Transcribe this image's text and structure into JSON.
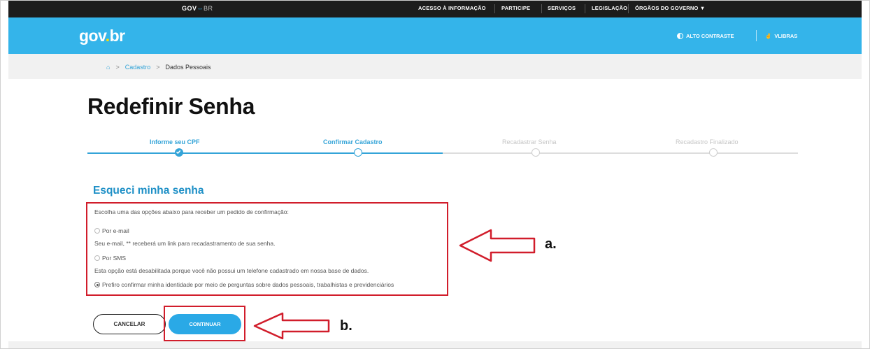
{
  "topbar": {
    "brand": "GOV",
    "brand_suffix": "BR",
    "links": [
      "ACESSO À INFORMAÇÃO",
      "PARTICIPE",
      "SERVIÇOS",
      "LEGISLAÇÃO",
      "ÓRGÃOS DO GOVERNO"
    ]
  },
  "header": {
    "logo_a": "gov",
    "logo_dot": ".",
    "logo_b": "br",
    "contrast_label": "ALTO CONTRASTE",
    "vlibras_label": "VLIBRAS"
  },
  "breadcrumb": {
    "home_icon": "home-icon",
    "items": [
      "Cadastro",
      "Dados Pessoais"
    ]
  },
  "page": {
    "title": "Redefinir Senha"
  },
  "stepper": {
    "steps": [
      {
        "label": "Informe seu CPF",
        "status": "done"
      },
      {
        "label": "Confirmar Cadastro",
        "status": "current"
      },
      {
        "label": "Recadastrar Senha",
        "status": "pending"
      },
      {
        "label": "Recadastro Finalizado",
        "status": "pending"
      }
    ]
  },
  "form": {
    "section_title": "Esqueci minha senha",
    "intro": "Escolha uma das opções abaixo para receber um pedido de confirmação:",
    "options": [
      {
        "label": "Por e-mail",
        "hint": "Seu e-mail, ** receberá um link para recadastramento de sua senha.",
        "selected": false
      },
      {
        "label": "Por SMS",
        "hint": "Esta opção está desabilitada porque você não possui um telefone cadastrado em nossa base de dados.",
        "selected": false
      },
      {
        "label": "Prefiro confirmar minha identidade por meio de perguntas sobre dados pessoais, trabalhistas e previdenciários",
        "hint": "",
        "selected": true
      }
    ],
    "cancel_label": "CANCELAR",
    "continue_label": "CONTINUAR"
  },
  "annotations": {
    "a": "a.",
    "b": "b."
  },
  "colors": {
    "accent": "#34b4ea",
    "primary_button": "#2aa9e6",
    "highlight_red": "#d11d2b",
    "topbar": "#1c1c1c"
  }
}
